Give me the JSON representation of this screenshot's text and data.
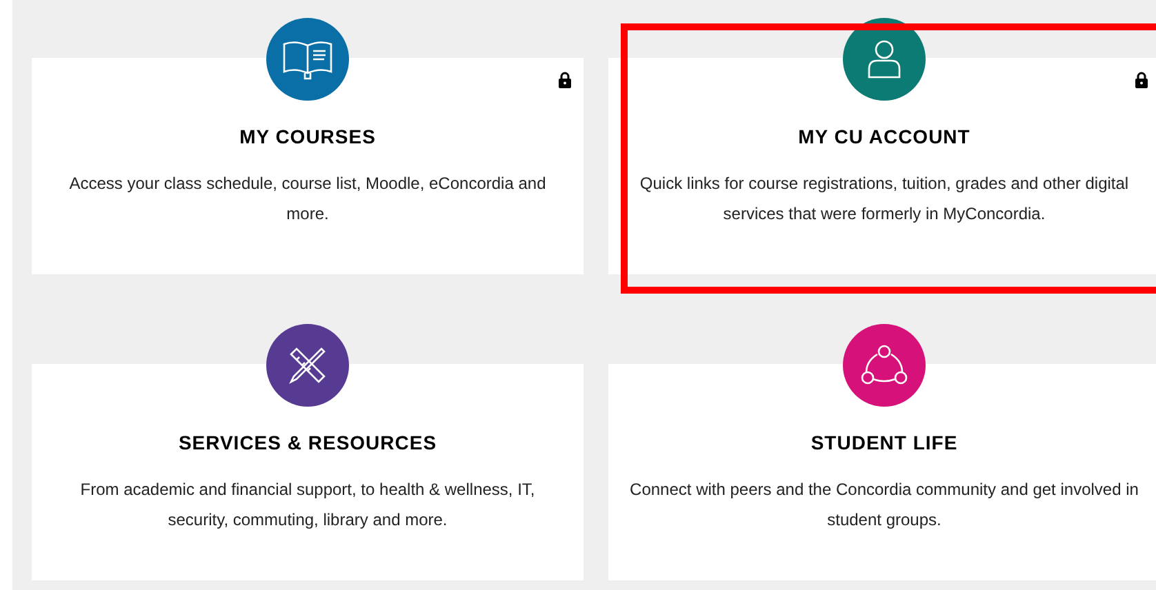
{
  "cards": [
    {
      "title": "MY COURSES",
      "description": "Access your class schedule, course list, Moodle, eConcordia and more.",
      "kind": "book",
      "color": "#0a6fa6",
      "locked": true,
      "highlighted": false
    },
    {
      "title": "MY CU ACCOUNT",
      "description": "Quick links for course registrations, tuition, grades and other digital services that were formerly in MyConcordia.",
      "kind": "person",
      "color": "#0b7b73",
      "locked": true,
      "highlighted": true
    },
    {
      "title": "SERVICES & RESOURCES",
      "description": "From academic and financial support, to health & wellness, IT, security, commuting, library and more.",
      "kind": "tools",
      "color": "#573a92",
      "locked": false,
      "highlighted": false
    },
    {
      "title": "STUDENT LIFE",
      "description": "Connect with peers and the Concordia community and get involved in student groups.",
      "kind": "network",
      "color": "#d6127a",
      "locked": false,
      "highlighted": false
    }
  ]
}
